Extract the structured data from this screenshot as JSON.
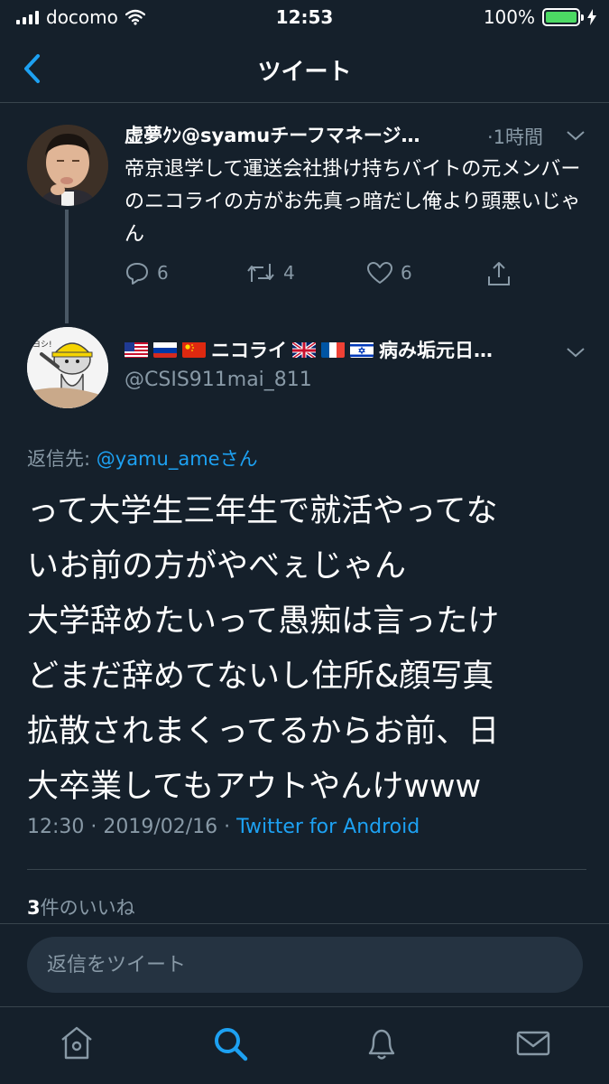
{
  "status_bar": {
    "carrier": "docomo",
    "time": "12:53",
    "battery": "100%"
  },
  "nav": {
    "title": "ツイート"
  },
  "parent_tweet": {
    "name": "虚夢ｸﾝ@syamuチーフマネージ…",
    "time": "·1時間",
    "text": "帝京退学して運送会社掛け持ちバイトの元メンバーのニコライの方がお先真っ暗だし俺より頭悪いじゃん",
    "reply_count": "6",
    "retweet_count": "4",
    "like_count": "6"
  },
  "main_tweet": {
    "name_prefix": "ニコライ",
    "name_suffix": "病み垢元日…",
    "handle": "@CSIS911mai_811",
    "reply_label": "返信先: ",
    "reply_target": "@yamu_ameさん",
    "text_lines": [
      "って大学生三年生で就活やってな",
      "いお前の方がやべぇじゃん",
      "大学辞めたいって愚痴は言ったけ",
      "どまだ辞めてないし住所&顔写真",
      "拡散されまくってるからお前、日",
      "大卒業してもアウトやんけwww"
    ],
    "time": "12:30 · 2019/02/16 · ",
    "source": "Twitter for Android",
    "likes_count": "3",
    "likes_label": "件のいいね"
  },
  "reply_box": {
    "placeholder": "返信をツイート"
  },
  "colors": {
    "background": "#15202b",
    "accent": "#1da1f2",
    "muted": "#8899a6"
  },
  "icons": [
    "back-chevron-icon",
    "reply-icon",
    "retweet-icon",
    "like-icon",
    "share-icon",
    "home-icon",
    "search-icon",
    "notifications-icon",
    "messages-icon"
  ]
}
